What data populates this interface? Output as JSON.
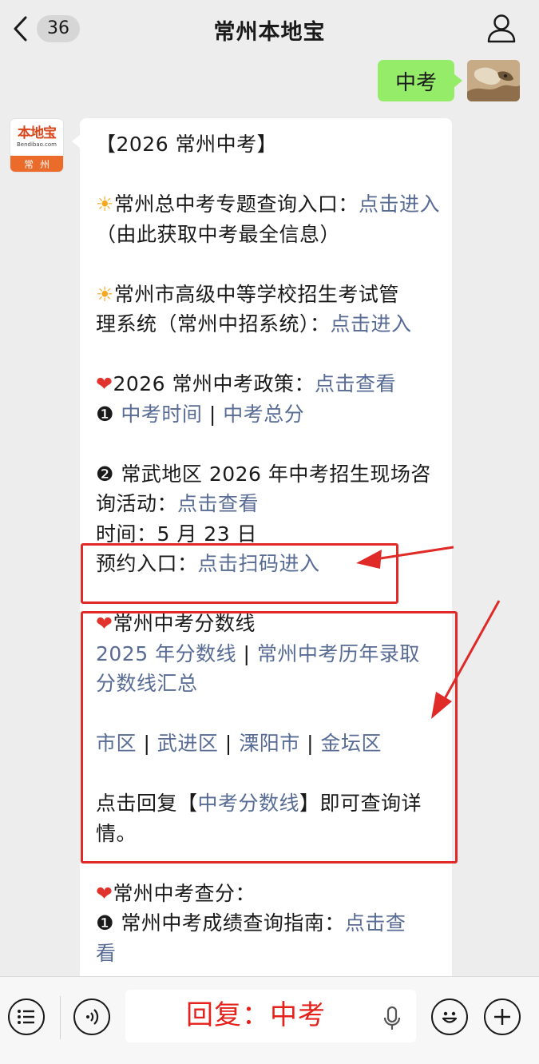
{
  "header": {
    "title": "常州本地宝",
    "unread_count": "36"
  },
  "sent_message": {
    "text": "中考"
  },
  "bot": {
    "logo_main": "本地宝",
    "logo_domain": "Bendibao.com",
    "logo_city": "常州"
  },
  "message": {
    "heading": "【2026 常州中考】",
    "item1_text": "常州总中考专题查询入口：",
    "item1_link": "点击进入",
    "item1_note": "（由此获取中考最全信息）",
    "item2_text_a": "常州市高级中等学校招生考试管",
    "item2_text_b": "理系统（常州中招系统）：",
    "item2_link": "点击进入",
    "policy_text": "2026 常州中考政策：",
    "policy_link": "点击查看",
    "marker1": "❶",
    "exam_time_link": "中考时间",
    "sep": " | ",
    "total_score_link": "中考总分",
    "marker2": "❷",
    "activity_text_a": "常武地区 2026 年中考招生现场咨",
    "activity_text_b": "询活动：",
    "activity_link": "点击查看",
    "time_text": "时间：5 月 23 日",
    "booking_text": "预约入口：",
    "booking_link": "点击扫码进入",
    "score_title": "常州中考分数线",
    "score_2025_link": "2025 年分数线",
    "score_history_link_a": "常州中考历年录取",
    "score_history_link_b": "分数线汇总",
    "district1": "市区",
    "district2": "武进区",
    "district3": "溧阳市",
    "district4": "金坛区",
    "reply_text_a": "点击回复【",
    "reply_link": "中考分数线",
    "reply_text_b": "】即可查询详",
    "reply_text_c": "情。",
    "check_title": "常州中考查分：",
    "guide_text": "常州中考成绩查询指南：",
    "guide_link_a": "点击查",
    "guide_link_b": "看"
  },
  "emoji": {
    "sun": "☀",
    "heart": "❤"
  },
  "input": {
    "text": "回复：中考"
  },
  "colors": {
    "link": "#576b95",
    "annotation": "#e02a27",
    "sent_bubble": "#95ec69"
  },
  "icons": [
    "back-chevron-icon",
    "profile-icon",
    "menu-icon",
    "voice-icon",
    "mic-icon",
    "emoji-icon",
    "plus-icon"
  ]
}
